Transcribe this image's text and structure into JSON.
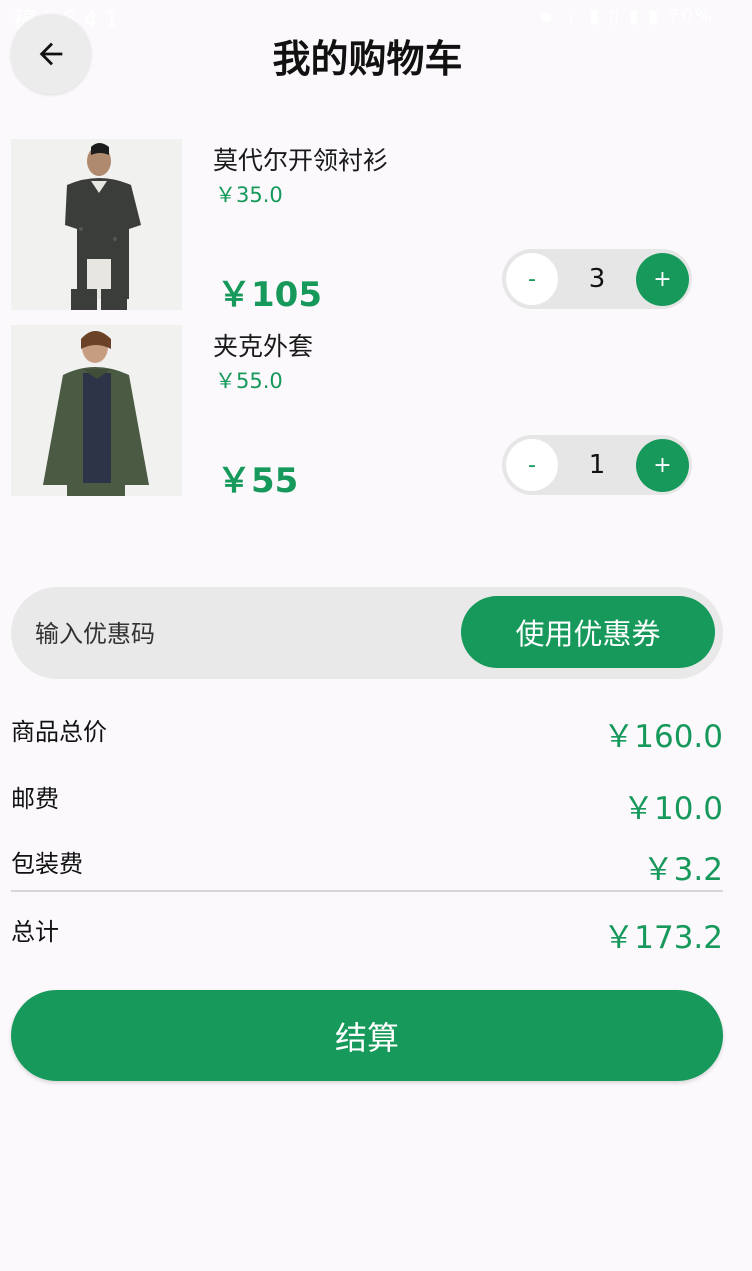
{
  "status_bar": {
    "left_text": "稿 L 6 4 1",
    "right_text": "▪ ⋮ ▮ ▯ ▮ ▮ 70%"
  },
  "header": {
    "title": "我的购物车",
    "back_icon": "arrow-left-icon"
  },
  "cart": {
    "items": [
      {
        "name": "莫代尔开领衬衫",
        "unit_price": "￥35.0",
        "total": "￥105",
        "quantity": "3",
        "minus": "-",
        "plus": "+"
      },
      {
        "name": "夹克外套",
        "unit_price": "￥55.0",
        "total": "￥55",
        "quantity": "1",
        "minus": "-",
        "plus": "+"
      }
    ]
  },
  "coupon": {
    "placeholder": "输入优惠码",
    "button_label": "使用优惠券"
  },
  "summary": {
    "subtotal_label": "商品总价",
    "subtotal_value": "￥160.0",
    "shipping_label": "邮费",
    "shipping_value": "￥10.0",
    "packaging_label": "包装费",
    "packaging_value": "￥3.2",
    "total_label": "总计",
    "total_value": "￥173.2"
  },
  "checkout": {
    "label": "结算"
  },
  "colors": {
    "accent": "#16995a",
    "background": "#fcf9fd",
    "pill": "#e9e9e9"
  }
}
